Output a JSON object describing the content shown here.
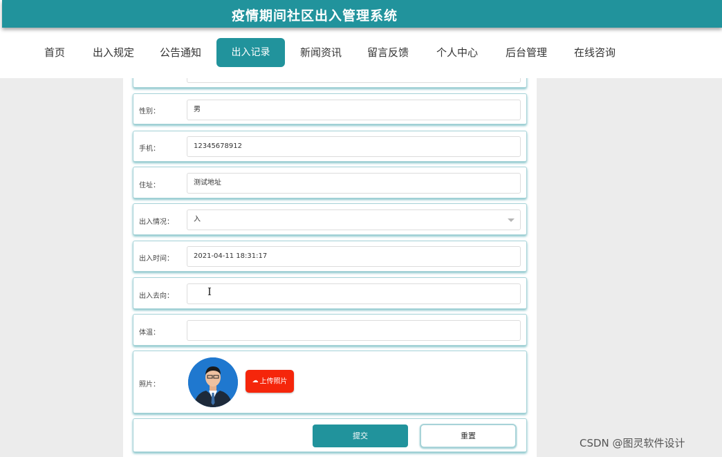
{
  "header": {
    "title": "疫情期间社区出入管理系统"
  },
  "nav": {
    "items": [
      {
        "label": "首页"
      },
      {
        "label": "出入规定"
      },
      {
        "label": "公告通知"
      },
      {
        "label": "出入记录",
        "active": true
      },
      {
        "label": "新闻资讯"
      },
      {
        "label": "留言反馈"
      },
      {
        "label": "个人中心"
      },
      {
        "label": "后台管理"
      },
      {
        "label": "在线咨询"
      }
    ]
  },
  "form": {
    "gender": {
      "label": "性别：",
      "value": "男"
    },
    "phone": {
      "label": "手机：",
      "value": "12345678912"
    },
    "address": {
      "label": "住址：",
      "value": "测试地址"
    },
    "status": {
      "label": "出入情况：",
      "value": "入"
    },
    "time": {
      "label": "出入时间：",
      "value": "2021-04-11 18:31:17"
    },
    "destination": {
      "label": "出入去向：",
      "value": ""
    },
    "temperature": {
      "label": "体温：",
      "value": ""
    },
    "photo": {
      "label": "照片：",
      "upload_label": "上传照片",
      "upload_icon": "cloud-upload-icon"
    },
    "submit_label": "提交",
    "reset_label": "重置"
  },
  "watermark": "CSDN @图灵软件设计",
  "colors": {
    "primary": "#21939c",
    "upload": "#f5260b",
    "background": "#ececec"
  }
}
